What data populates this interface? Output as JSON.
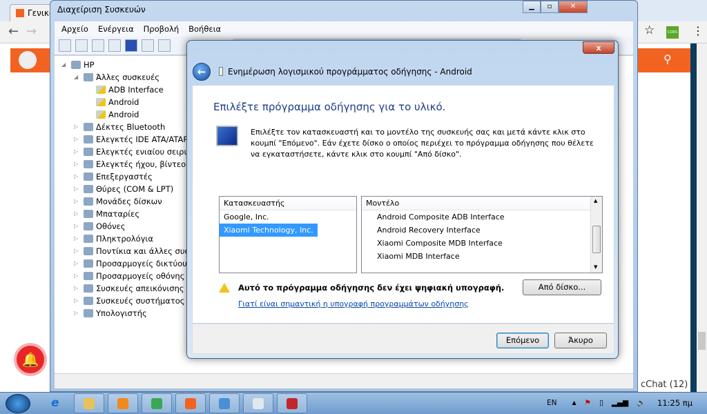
{
  "browser": {
    "tab_title": "Γενικά",
    "chat_label": "cChat (12)",
    "ext_label": "CORS"
  },
  "device_manager": {
    "title": "Διαχείριση Συσκευών",
    "menu": [
      "Αρχείο",
      "Ενέργεια",
      "Προβολή",
      "Βοήθεια"
    ],
    "tree": [
      {
        "label": "HP",
        "level": 0,
        "expander": "◢",
        "warn": false
      },
      {
        "label": "Άλλες συσκευές",
        "level": 1,
        "expander": "◢",
        "warn": false
      },
      {
        "label": "ADB Interface",
        "level": 2,
        "expander": "",
        "warn": true
      },
      {
        "label": "Android",
        "level": 2,
        "expander": "",
        "warn": true
      },
      {
        "label": "Android",
        "level": 2,
        "expander": "",
        "warn": true
      },
      {
        "label": "Δέκτες Bluetooth",
        "level": 1,
        "expander": "▷",
        "warn": false
      },
      {
        "label": "Ελεγκτές IDE ATA/ATAPI",
        "level": 1,
        "expander": "▷",
        "warn": false
      },
      {
        "label": "Ελεγκτές ενιαίου σειριακού",
        "level": 1,
        "expander": "▷",
        "warn": false
      },
      {
        "label": "Ελεγκτές ήχου, βίντεο και",
        "level": 1,
        "expander": "▷",
        "warn": false
      },
      {
        "label": "Επεξεργαστές",
        "level": 1,
        "expander": "▷",
        "warn": false
      },
      {
        "label": "Θύρες (COM & LPT)",
        "level": 1,
        "expander": "▷",
        "warn": false
      },
      {
        "label": "Μονάδες δίσκων",
        "level": 1,
        "expander": "▷",
        "warn": false
      },
      {
        "label": "Μπαταρίες",
        "level": 1,
        "expander": "▷",
        "warn": false
      },
      {
        "label": "Οθόνες",
        "level": 1,
        "expander": "▷",
        "warn": false
      },
      {
        "label": "Πληκτρολόγια",
        "level": 1,
        "expander": "▷",
        "warn": false
      },
      {
        "label": "Ποντίκια και άλλες συσκευές",
        "level": 1,
        "expander": "▷",
        "warn": false
      },
      {
        "label": "Προσαρμογείς δικτύου",
        "level": 1,
        "expander": "▷",
        "warn": false
      },
      {
        "label": "Προσαρμογείς οθόνης",
        "level": 1,
        "expander": "▷",
        "warn": false
      },
      {
        "label": "Συσκευές απεικόνισης",
        "level": 1,
        "expander": "▷",
        "warn": false
      },
      {
        "label": "Συσκευές συστήματος",
        "level": 1,
        "expander": "▷",
        "warn": false
      },
      {
        "label": "Υπολογιστής",
        "level": 1,
        "expander": "▷",
        "warn": false
      }
    ]
  },
  "dialog": {
    "title": "Ενημέρωση λογισμικού προγράμματος οδήγησης - Android",
    "close": "x",
    "back": "←",
    "heading": "Επιλέξτε πρόγραμμα οδήγησης για το υλικό.",
    "description": "Επιλέξτε τον κατασκευαστή και το μοντέλο της συσκευής σας και μετά κάντε κλικ στο κουμπί \"Επόμενο\". Εάν έχετε δίσκο ο οποίος περιέχει το πρόγραμμα οδήγησης που θέλετε να εγκαταστήσετε, κάντε κλικ στο κουμπί \"Από δίσκο\".",
    "manufacturer_header": "Κατασκευαστής",
    "manufacturers": [
      "Google, Inc.",
      "Xiaomi Technology, Inc."
    ],
    "selected_manufacturer": "Xiaomi Technology, Inc.",
    "model_header": "Μοντέλο",
    "models": [
      "Android Composite ADB Interface",
      "Android Recovery Interface",
      "Xiaomi Composite MDB Interface",
      "Xiaomi MDB Interface"
    ],
    "warning": "Αυτό το πρόγραμμα οδήγησης δεν έχει ψηφιακή υπογραφή.",
    "warning_link": "Γιατί είναι σημαντική η υπογραφή προγραμμάτων οδήγησης",
    "from_disk": "Από δίσκο...",
    "next": "Επόμενο",
    "cancel": "Άκυρο"
  },
  "taskbar": {
    "apps": [
      {
        "name": "explorer",
        "color": "#e9c15a"
      },
      {
        "name": "media",
        "color": "#f08a1c"
      },
      {
        "name": "chrome",
        "color": "#3aa757"
      },
      {
        "name": "mi",
        "color": "#f26322"
      },
      {
        "name": "app",
        "color": "#4a8fd6"
      },
      {
        "name": "notepad",
        "color": "#dfe8f0"
      },
      {
        "name": "firewall",
        "color": "#c0262c"
      }
    ],
    "lang": "EN",
    "tray_arrow": "▲",
    "clock": "11:25 πμ"
  }
}
